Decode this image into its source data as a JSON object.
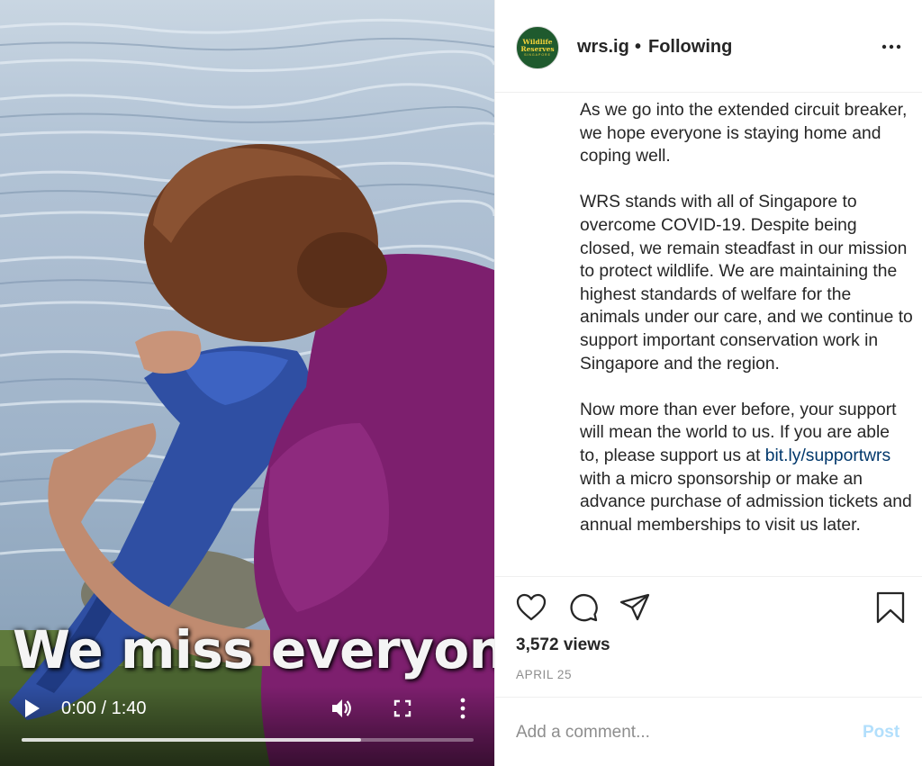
{
  "video": {
    "caption_overlay": "We miss everyone,",
    "time_display": "0:00 / 1:40",
    "buffered_fraction": 0.75,
    "icons": [
      "play-icon",
      "volume-icon",
      "fullscreen-icon",
      "more-options-icon"
    ]
  },
  "header": {
    "avatar_line1": "Wildlife",
    "avatar_line2": "Reserves",
    "avatar_line3": "SINGAPORE",
    "username": "wrs.ig",
    "separator": "•",
    "follow_status": "Following",
    "menu_icon": "more-horizontal-icon"
  },
  "caption": {
    "p1": "As we go into the extended circuit breaker, we hope everyone is staying home and coping well.",
    "p2": "WRS stands with all of Singapore to overcome COVID-19. Despite being closed, we remain steadfast in our mission to protect wildlife. We are maintaining the highest standards of welfare for the animals under our care, and we continue to support important conservation work in Singapore and the region.",
    "p3_before_link": "Now more than ever before, your support will mean the world to us. If you are able to, please support us at ",
    "p3_link": "bit.ly/supportwrs",
    "p3_after_link": " with a micro sponsorship or make an advance purchase of admission tickets and annual memberships to visit us later."
  },
  "actions": {
    "icons": [
      "heart-icon",
      "comment-icon",
      "share-icon",
      "bookmark-icon"
    ],
    "views": "3,572 views",
    "date": "APRIL 25"
  },
  "comment": {
    "placeholder": "Add a comment...",
    "post_label": "Post"
  },
  "colors": {
    "link": "#00376b",
    "post_disabled": "#b2dffc",
    "secondary_text": "#8e8e8e",
    "avatar_bg": "#1f5a2e",
    "avatar_text": "#f5d43a"
  }
}
